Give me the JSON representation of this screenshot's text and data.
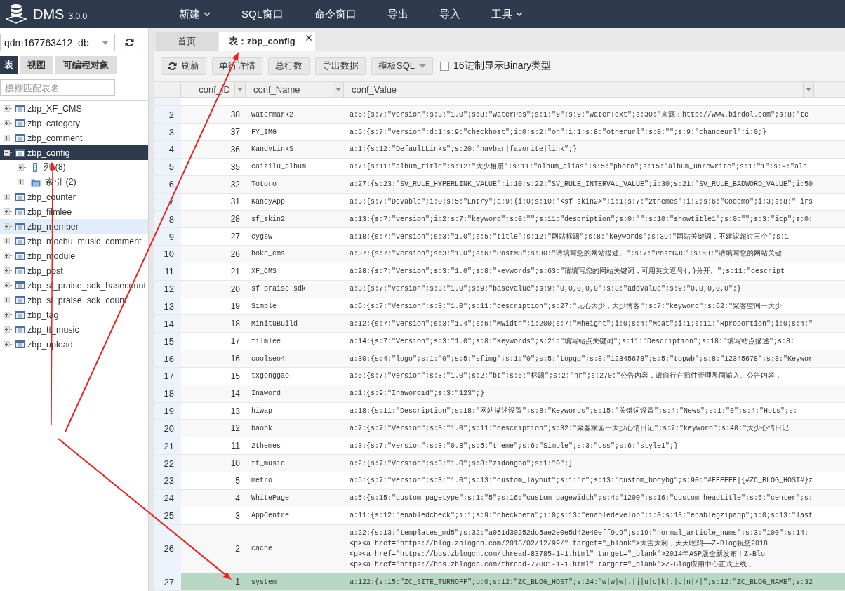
{
  "app": {
    "name": "DMS",
    "version": "3.0.0"
  },
  "menu": [
    {
      "label": "新建",
      "dropdown": true
    },
    {
      "label": "SQL窗口",
      "dropdown": false
    },
    {
      "label": "命令窗口",
      "dropdown": false
    },
    {
      "label": "导出",
      "dropdown": false
    },
    {
      "label": "导入",
      "dropdown": false
    },
    {
      "label": "工具",
      "dropdown": true
    }
  ],
  "sidebar": {
    "database": "qdm167763412_db",
    "tabs": [
      {
        "label": "表",
        "selected": true
      },
      {
        "label": "视图",
        "selected": false
      },
      {
        "label": "可编程对象",
        "selected": false
      }
    ],
    "filter": {
      "placeholder": "模糊匹配表名"
    },
    "tables": [
      {
        "name": "zbp_XF_CMS",
        "expanded": false,
        "selected": false,
        "highlighted": false
      },
      {
        "name": "zbp_category",
        "expanded": false,
        "selected": false,
        "highlighted": false
      },
      {
        "name": "zbp_comment",
        "expanded": false,
        "selected": false,
        "highlighted": false
      },
      {
        "name": "zbp_config",
        "expanded": true,
        "selected": true,
        "highlighted": false,
        "children": [
          {
            "kind": "columns",
            "label": "列 (8)",
            "expanded": false
          },
          {
            "kind": "indexes",
            "label": "索引 (2)",
            "expanded": false
          }
        ]
      },
      {
        "name": "zbp_counter",
        "expanded": false,
        "selected": false,
        "highlighted": false
      },
      {
        "name": "zbp_filmlee",
        "expanded": false,
        "selected": false,
        "highlighted": false
      },
      {
        "name": "zbp_member",
        "expanded": false,
        "selected": false,
        "highlighted": true
      },
      {
        "name": "zbp_mochu_music_comment",
        "expanded": false,
        "selected": false,
        "highlighted": false
      },
      {
        "name": "zbp_module",
        "expanded": false,
        "selected": false,
        "highlighted": false
      },
      {
        "name": "zbp_post",
        "expanded": false,
        "selected": false,
        "highlighted": false
      },
      {
        "name": "zbp_sf_praise_sdk_basecount",
        "expanded": false,
        "selected": false,
        "highlighted": false
      },
      {
        "name": "zbp_sf_praise_sdk_count",
        "expanded": false,
        "selected": false,
        "highlighted": false
      },
      {
        "name": "zbp_tag",
        "expanded": false,
        "selected": false,
        "highlighted": false
      },
      {
        "name": "zbp_tt_music",
        "expanded": false,
        "selected": false,
        "highlighted": false
      },
      {
        "name": "zbp_upload",
        "expanded": false,
        "selected": false,
        "highlighted": false
      }
    ]
  },
  "tabs": [
    {
      "label": "首页",
      "selected": false,
      "closable": false
    },
    {
      "label": "表：zbp_config",
      "selected": true,
      "closable": true
    }
  ],
  "toolbar": {
    "buttons": [
      {
        "label": "刷新",
        "kind": "refresh"
      },
      {
        "label": "单行详情",
        "kind": "plain"
      },
      {
        "label": "总行数",
        "kind": "plain"
      },
      {
        "label": "导出数据",
        "kind": "plain"
      },
      {
        "label": "模板SQL",
        "kind": "dropdown"
      }
    ],
    "checkbox": {
      "label": "16进制显示Binary类型",
      "checked": false
    }
  },
  "table": {
    "columns": [
      "conf_ID",
      "conf_Name",
      "conf_Value"
    ],
    "rows": [
      {
        "number": "2",
        "id": "38",
        "name": "Watermark2",
        "selected": false,
        "value": [
          "a:6:{s:7:\"Version\";s:3:\"1.0\";s:8:\"waterPos\";s:1:\"9\";s:9:\"waterText\";s:30:\"来源：http://www.birdol.com\";s:8:\"te"
        ]
      },
      {
        "number": "3",
        "id": "37",
        "name": "FY_IMG",
        "selected": false,
        "value": [
          "a:5:{s:7:\"version\";d:1;s:9:\"checkhost\";i:0;s:2:\"on\";i:1;s:8:\"otherurl\";s:0:\"\";s:9:\"changeurl\";i:0;}"
        ]
      },
      {
        "number": "4",
        "id": "36",
        "name": "KandyLinkS",
        "selected": false,
        "value": [
          "a:1:{s:12:\"DefaultLinks\";s:20:\"navbar|favorite|link\";}"
        ]
      },
      {
        "number": "5",
        "id": "35",
        "name": "caizilu_album",
        "selected": false,
        "value": [
          "a:7:{s:11:\"album_title\";s:12:\"大少相册\";s:11:\"album_alias\";s:5:\"photo\";s:15:\"album_unrewrite\";s:1:\"1\";s:9:\"alb"
        ]
      },
      {
        "number": "6",
        "id": "32",
        "name": "Totoro",
        "selected": false,
        "value": [
          "a:27:{s:23:\"SV_RULE_HYPERLINK_VALUE\";i:10;s:22:\"SV_RULE_INTERVAL_VALUE\";i:30;s:21:\"SV_RULE_BADWORD_VALUE\";i:50"
        ]
      },
      {
        "number": "7",
        "id": "31",
        "name": "KandyApp",
        "selected": false,
        "value": [
          "a:3:{s:7:\"Devable\";i:0;s:5:\"Entry\";a:9:{i:0;s:10:\"<sf_skin2>\";i:1;s:7:\"2themes\";i:2;s:6:\"Codemo\";i:3;s:8:\"Firs"
        ]
      },
      {
        "number": "8",
        "id": "28",
        "name": "sf_skin2",
        "selected": false,
        "value": [
          "a:13:{s:7:\"version\";i:2;s:7:\"keyword\";s:0:\"\";s:11:\"description\";s:0:\"\";s:10:\"showtitle1\";s:0:\"\";s:3:\"icp\";s:0:"
        ]
      },
      {
        "number": "9",
        "id": "27",
        "name": "cygsw",
        "selected": false,
        "value": [
          "a:18:{s:7:\"Version\";s:3:\"1.0\";s:5:\"title\";s:12:\"网站标题\";s:8:\"keywords\";s:39:\"网站关键词，不建议超过三个\";s:1"
        ]
      },
      {
        "number": "10",
        "id": "26",
        "name": "boke_cms",
        "selected": false,
        "value": [
          "a:37:{s:7:\"Version\";s:3:\"1.0\";s:6:\"PostMS\";s:30:\"请填写您的网站描述。\";s:7:\"PostGJC\";s:63:\"请填写您的网站关键"
        ]
      },
      {
        "number": "11",
        "id": "21",
        "name": "XF_CMS",
        "selected": false,
        "value": [
          "a:28:{s:7:\"Version\";s:3:\"1.0\";s:8:\"keywords\";s:63:\"请填写您的网站关键词，可用英文逗号(,)分开。\";s:11:\"descript"
        ]
      },
      {
        "number": "12",
        "id": "20",
        "name": "sf_praise_sdk",
        "selected": false,
        "value": [
          "a:3:{s:7:\"version\";s:3:\"1.0\";s:9:\"basevalue\";s:9:\"0,0,0,0,0\";s:8:\"addvalue\";s:9:\"0,0,0,0,0\";}"
        ]
      },
      {
        "number": "13",
        "id": "19",
        "name": "Simple",
        "selected": false,
        "value": [
          "a:6:{s:7:\"Version\";s:3:\"1.0\";s:11:\"description\";s:27:\"无心大少，大少博客\";s:7:\"keyword\";s:62:\"聚客空间一大少"
        ]
      },
      {
        "number": "14",
        "id": "18",
        "name": "MinituBuild",
        "selected": false,
        "value": [
          "a:12:{s:7:\"version\";s:3:\"1.4\";s:6:\"Mwidth\";i:200;s:7:\"Mheight\";i:0;s:4:\"Mcat\";i:1;s:11:\"Rproportion\";i:0;s:4:\""
        ]
      },
      {
        "number": "15",
        "id": "17",
        "name": "filmlee",
        "selected": false,
        "value": [
          "a:14:{s:7:\"Version\";s:3:\"1.0\";s:8:\"Keywords\";s:21:\"填写站点关键词\";s:11:\"Description\";s:18:\"填写站点描述\";s:8:"
        ]
      },
      {
        "number": "16",
        "id": "16",
        "name": "coolseo4",
        "selected": false,
        "value": [
          "a:30:{s:4:\"logo\";s:1:\"0\";s:5:\"sfimg\";s:1:\"0\";s:5:\"topqq\";s:8:\"12345678\";s:5:\"topwb\";s:8:\"12345678\";s:8:\"Keywor"
        ]
      },
      {
        "number": "17",
        "id": "15",
        "name": "txgonggao",
        "selected": false,
        "value": [
          "a:6:{s:7:\"version\";s:3:\"1.0\";s:2:\"bt\";s:6:\"标题\";s:2:\"nr\";s:270:\"公告内容，请自行在插件管理界面输入。公告内容，"
        ]
      },
      {
        "number": "18",
        "id": "14",
        "name": "Inaword",
        "selected": false,
        "value": [
          "a:1:{s:9:\"Inawordid\";s:3:\"123\";}"
        ]
      },
      {
        "number": "19",
        "id": "13",
        "name": "hiwap",
        "selected": false,
        "value": [
          "a:18:{s:11:\"Description\";s:18:\"网站描述设置\";s:8:\"Keywords\";s:15:\"关键词设置\";s:4:\"News\";s:1:\"0\";s:4:\"Hots\";s:"
        ]
      },
      {
        "number": "20",
        "id": "12",
        "name": "baobk",
        "selected": false,
        "value": [
          "a:7:{s:7:\"Version\";s:3:\"1.0\";s:11:\"description\";s:32:\"聚客家园一大少心情日记\";s:7:\"keyword\";s:48:\"大少心情日记"
        ]
      },
      {
        "number": "21",
        "id": "11",
        "name": "2themes",
        "selected": false,
        "value": [
          "a:3:{s:7:\"version\";s:3:\"0.8\";s:5:\"theme\";s:6:\"Simple\";s:3:\"css\";s:6:\"style1\";}"
        ]
      },
      {
        "number": "22",
        "id": "10",
        "name": "tt_music",
        "selected": false,
        "value": [
          "a:2:{s:7:\"Version\";s:3:\"1.0\";s:8:\"zidongbo\";s:1:\"0\";}"
        ]
      },
      {
        "number": "23",
        "id": "5",
        "name": "metro",
        "selected": false,
        "value": [
          "a:5:{s:7:\"version\";s:3:\"1.0\";s:13:\"custom_layout\";s:1:\"r\";s:13:\"custom_bodybg\";s:90:\"#EEEEEE|{#ZC_BLOG_HOST#}z"
        ]
      },
      {
        "number": "24",
        "id": "4",
        "name": "WhitePage",
        "selected": false,
        "value": [
          "a:5:{s:15:\"custom_pagetype\";s:1:\"5\";s:16:\"custom_pagewidth\";s:4:\"1200\";s:16:\"custom_headtitle\";s:6:\"center\";s:"
        ]
      },
      {
        "number": "25",
        "id": "3",
        "name": "AppCentre",
        "selected": false,
        "value": [
          "a:11:{s:12:\"enabledcheck\";i:1;s:9:\"checkbeta\";i:0;s:13:\"enabledevelop\";i:0;s:13:\"enablegzipapp\";i:0;s:13:\"last"
        ]
      },
      {
        "number": "26",
        "id": "2",
        "name": "cache",
        "selected": false,
        "value": [
          "a:22:{s:13:\"templates_md5\";s:32:\"a051d30252dc5ae2e0e5d42e40eff9c9\";s:19:\"normal_article_nums\";s:3:\"100\";s:14:",
          "<p><a href=\"https://blog.zblogcn.com/2018/02/12/99/\" target=\"_blank\">大吉大利，天天吃鸡——Z-Blog祝您2018",
          "<p><a href=\"https://bbs.zblogcn.com/thread-83785-1-1.html\" target=\"_blank\">2014年ASP版全新发布！Z-Blo",
          "<p><a href=\"https://bbs.zblogcn.com/thread-77001-1-1.html\" target=\"_blank\">Z-Blog应用中心正式上线，"
        ]
      },
      {
        "number": "27",
        "id": "1",
        "name": "system",
        "selected": true,
        "value": [
          "a:122:{s:15:\"ZC_SITE_TURNOFF\";b:0;s:12:\"ZC_BLOG_HOST\";s:24:\"w|w|w|.|j|u|c|k|.|c|n|/|\";s:12:\"ZC_BLOG_NAME\";s:32"
        ]
      }
    ]
  }
}
